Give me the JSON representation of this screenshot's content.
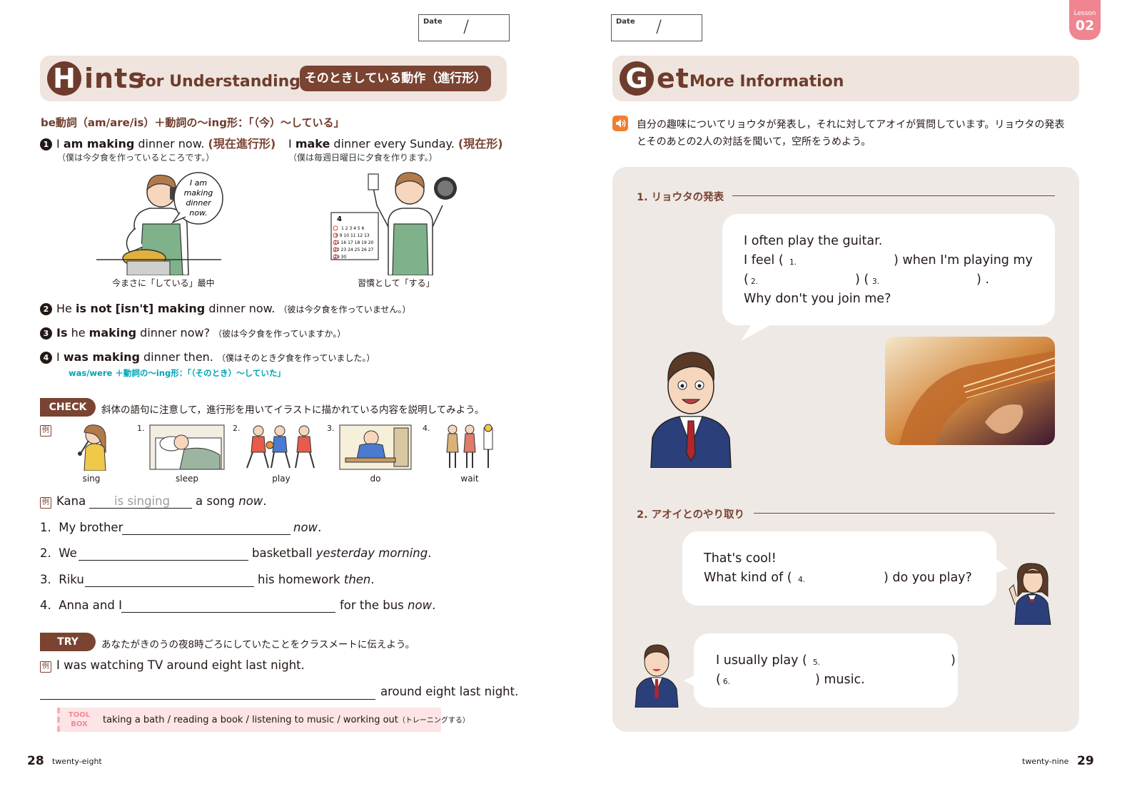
{
  "left_page": {
    "date_label": "Date",
    "date_slash": "/",
    "title": {
      "letter": "H",
      "rest": "ints",
      "small": "for Understanding",
      "pill": "そのときしている動作（進行形）"
    },
    "rule": "be動詞（am/are/is）＋動詞の～ing形：「（今）～している」",
    "examples": [
      {
        "mark": "1",
        "pre": "I ",
        "bold": "am making",
        "post": " dinner now. ",
        "tag": "(現在進行形)",
        "translation": "（僕は今夕食を作っているところです。）"
      },
      {
        "mark": "",
        "pre": "I ",
        "bold": "make",
        "post": " dinner every Sunday. ",
        "tag": "(現在形)",
        "translation": "（僕は毎週日曜日に夕食を作ります。）"
      }
    ],
    "bubble_text": [
      "I am",
      "making",
      "dinner",
      "now."
    ],
    "calendar_text": {
      "month": "4",
      "rows": [
        "1 2 3 4 5 6",
        "8 9 10 11 12 13",
        "15 16 17 18 19 20",
        "22 23 24 25 26 27",
        "29 30"
      ]
    },
    "caption1": "今まさに「している」最中",
    "caption2": "習慣として「する」",
    "ex2": {
      "mark": "2",
      "pre": "He ",
      "bold": "is not",
      "bracket": "[isn't]",
      "bold2": " making",
      "post": " dinner now.",
      "translation": "（彼は今夕食を作っていません。）"
    },
    "ex3": {
      "mark": "3",
      "bold": "Is",
      "pre": " he ",
      "bold2": "making",
      "post": " dinner now?",
      "translation": "（彼は今夕食を作っていますか。）"
    },
    "ex4": {
      "mark": "4",
      "pre": "I ",
      "bold": "was making",
      "post": " dinner then.",
      "translation": "（僕はそのとき夕食を作っていました。）"
    },
    "ex4_note": "was/were ＋動詞の～ing形：「（そのとき）～していた」",
    "check": {
      "label": "CHECK",
      "instruction": "斜体の語句に注意して，進行形を用いてイラストに描かれている内容を説明してみよう。"
    },
    "example_mark": "例",
    "pictures": [
      {
        "num": "例",
        "word": "sing"
      },
      {
        "num": "1.",
        "word": "sleep"
      },
      {
        "num": "2.",
        "word": "play"
      },
      {
        "num": "3.",
        "word": "do"
      },
      {
        "num": "4.",
        "word": "wait"
      }
    ],
    "sentences": {
      "ex": {
        "pre": "Kana",
        "answer": "is singing",
        "post": "a song ",
        "italic": "now",
        "end": "."
      },
      "s1": {
        "num": "1.",
        "pre": "My brother",
        "italic": "now",
        "end": "."
      },
      "s2": {
        "num": "2.",
        "pre": "We",
        "post": "basketball ",
        "italic": "yesterday morning",
        "end": "."
      },
      "s3": {
        "num": "3.",
        "pre": "Riku",
        "post": "his homework ",
        "italic": "then",
        "end": "."
      },
      "s4": {
        "num": "4.",
        "pre": "Anna and I",
        "post": "for the bus ",
        "italic": "now",
        "end": "."
      }
    },
    "try": {
      "label": "TRY",
      "instruction": "あなたがきのうの夜8時ごろにしていたことをクラスメートに伝えよう。"
    },
    "try_example": "I was watching TV around eight last night.",
    "try_blank_end": "around eight last night.",
    "toolbox": {
      "label1": "TOOL",
      "label2": "BOX",
      "text": "taking a bath / reading a book / listening to music / working out",
      "note": "（トレーニングする）"
    },
    "page_number": "28",
    "page_word": "twenty-eight"
  },
  "right_page": {
    "date_label": "Date",
    "date_slash": "/",
    "lesson": {
      "label": "Lesson",
      "number": "02"
    },
    "title": {
      "letter": "G",
      "rest": "et",
      "small": "More Information"
    },
    "instruction": [
      "自分の趣味についてリョウタが発表し，それに対してアオイが質問しています。リョウタの発表",
      "とそのあとの2人の対話を聞いて，空所をうめよう。"
    ],
    "section1": "1. リョウタの発表",
    "bubble1": {
      "l1": "I often play the guitar.",
      "l2_pre": "I feel (",
      "n1": "1.",
      "l2_mid": ") when I'm playing my",
      "n2": "2.",
      "n3": "3.",
      "l4": "Why don't you join me?"
    },
    "section2": "2. アオイとのやり取り",
    "bubble2": {
      "l1": "That's cool!",
      "l2_pre": "What kind of (",
      "n4": "4.",
      "l2_post": ") do you play?"
    },
    "bubble3": {
      "l1_pre": "I usually play (",
      "n5": "5.",
      "n6": "6.",
      "l2_post": ") music."
    },
    "page_number": "29",
    "page_word": "twenty-nine"
  },
  "colors": {
    "brown": "#7a4332",
    "title_bg": "#efe4de",
    "panel_bg": "#efe9e6",
    "teal": "#00a3b4",
    "pink": "#ef8590",
    "orange": "#ef7f30"
  }
}
